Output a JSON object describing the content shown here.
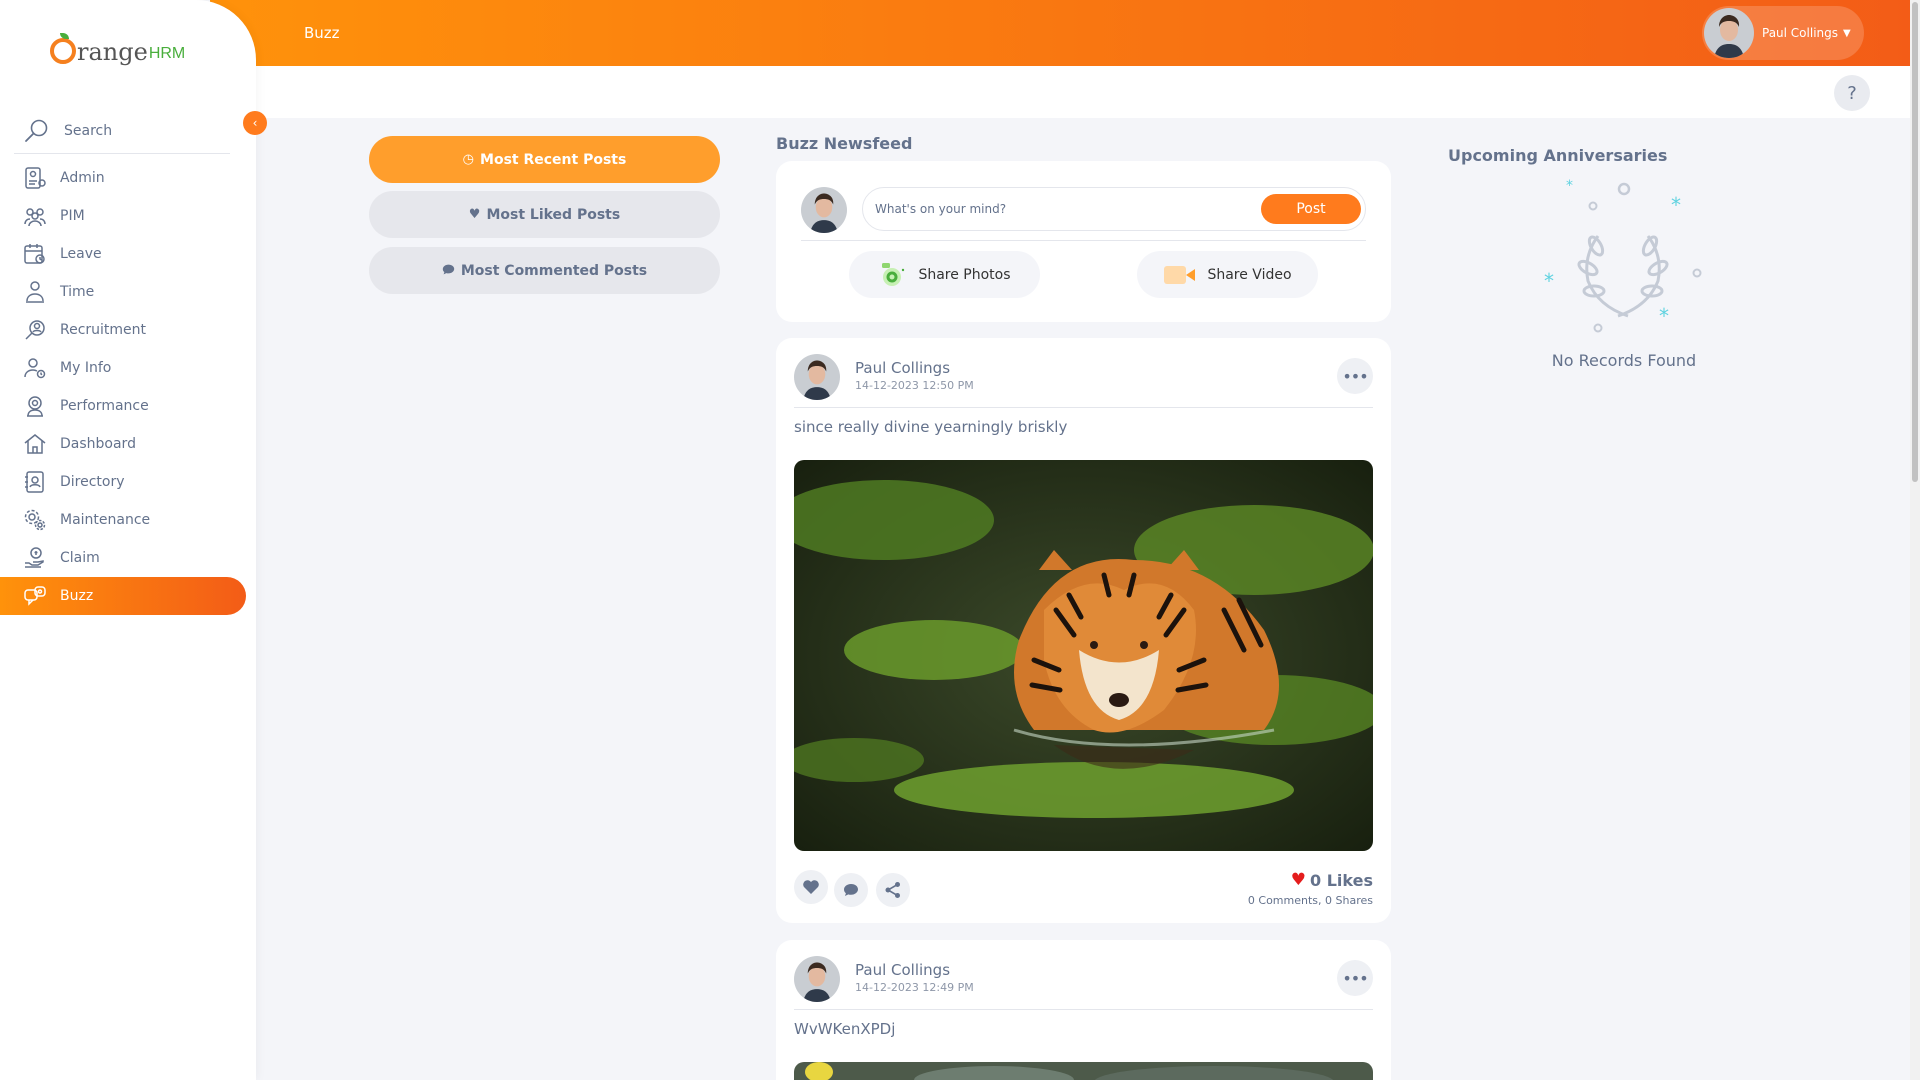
{
  "app": {
    "logo_text": "range",
    "logo_suffix": "HRM"
  },
  "search": {
    "placeholder": "Search"
  },
  "sidebar": {
    "items": [
      {
        "label": "Admin",
        "icon": "admin-icon"
      },
      {
        "label": "PIM",
        "icon": "pim-icon"
      },
      {
        "label": "Leave",
        "icon": "leave-icon"
      },
      {
        "label": "Time",
        "icon": "time-icon"
      },
      {
        "label": "Recruitment",
        "icon": "recruitment-icon"
      },
      {
        "label": "My Info",
        "icon": "my-info-icon"
      },
      {
        "label": "Performance",
        "icon": "performance-icon"
      },
      {
        "label": "Dashboard",
        "icon": "dashboard-icon"
      },
      {
        "label": "Directory",
        "icon": "directory-icon"
      },
      {
        "label": "Maintenance",
        "icon": "maintenance-icon"
      },
      {
        "label": "Claim",
        "icon": "claim-icon"
      },
      {
        "label": "Buzz",
        "icon": "buzz-icon",
        "active": true
      }
    ]
  },
  "header": {
    "title": "Buzz",
    "user_name": "Paul Collings",
    "help": "?"
  },
  "filters": {
    "most_recent": "Most Recent Posts",
    "most_liked": "Most Liked Posts",
    "most_commented": "Most Commented Posts"
  },
  "feed": {
    "title": "Buzz Newsfeed",
    "composer_placeholder": "What's on your mind?",
    "post_button": "Post",
    "share_photos": "Share Photos",
    "share_video": "Share Video"
  },
  "posts": [
    {
      "author": "Paul Collings",
      "date": "14-12-2023 12:50 PM",
      "text": "since really divine yearningly briskly",
      "likes_label": "0 Likes",
      "comments_label": "0 Comments",
      "shares_label": "0 Shares"
    },
    {
      "author": "Paul Collings",
      "date": "14-12-2023 12:49 PM",
      "text": "WvWKenXPDj"
    }
  ],
  "anniversaries": {
    "title": "Upcoming Anniversaries",
    "empty": "No Records Found"
  },
  "colors": {
    "accent": "#ff7b1d",
    "accent_light": "#ff9e2c",
    "text": "#64728c",
    "like": "#e41d1d"
  }
}
